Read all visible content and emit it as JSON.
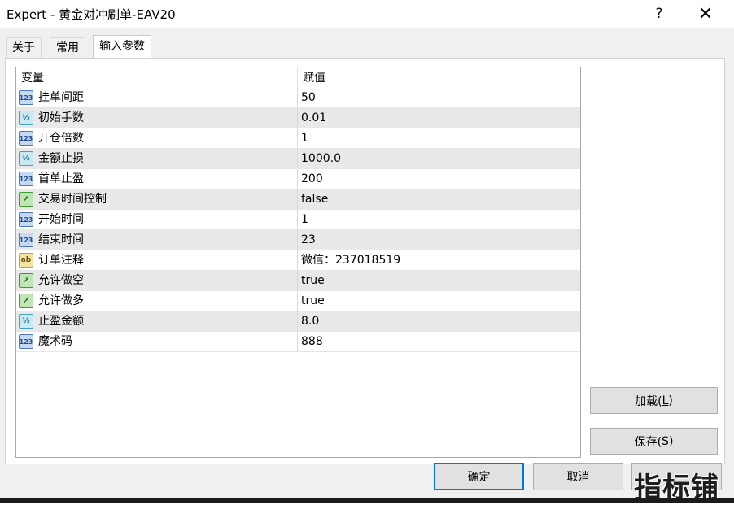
{
  "window": {
    "title": "Expert - 黄金对冲刷单-EAV20",
    "help_label": "?",
    "close_label": "✕"
  },
  "tabs": [
    {
      "label": "关于"
    },
    {
      "label": "常用"
    },
    {
      "label": "输入参数",
      "active": true
    }
  ],
  "grid": {
    "columns": [
      "变量",
      "赋值"
    ],
    "rows": [
      {
        "type": "int",
        "icon": "123",
        "name": "挂单间距",
        "value": "50"
      },
      {
        "type": "double",
        "icon": "½",
        "name": "初始手数",
        "value": "0.01"
      },
      {
        "type": "int",
        "icon": "123",
        "name": "开仓倍数",
        "value": "1"
      },
      {
        "type": "double",
        "icon": "½",
        "name": "金额止损",
        "value": "1000.0"
      },
      {
        "type": "int",
        "icon": "123",
        "name": "首单止盈",
        "value": "200"
      },
      {
        "type": "bool",
        "icon": "↗",
        "name": "交易时间控制",
        "value": "false"
      },
      {
        "type": "int",
        "icon": "123",
        "name": "开始时间",
        "value": "1"
      },
      {
        "type": "int",
        "icon": "123",
        "name": "结束时间",
        "value": "23"
      },
      {
        "type": "string",
        "icon": "ab",
        "name": "订单注释",
        "value": "微信：237018519"
      },
      {
        "type": "bool",
        "icon": "↗",
        "name": "允许做空",
        "value": "true"
      },
      {
        "type": "bool",
        "icon": "↗",
        "name": "允许做多",
        "value": "true"
      },
      {
        "type": "double",
        "icon": "½",
        "name": "止盈金额",
        "value": "8.0"
      },
      {
        "type": "int",
        "icon": "123",
        "name": "魔术码",
        "value": "888"
      }
    ]
  },
  "buttons": {
    "load_text": "加载(",
    "load_key": "L",
    "load_end": ")",
    "save_text": "保存(",
    "save_key": "S",
    "save_end": ")",
    "ok": "确定",
    "cancel": "取消"
  },
  "watermark": "指标铺"
}
